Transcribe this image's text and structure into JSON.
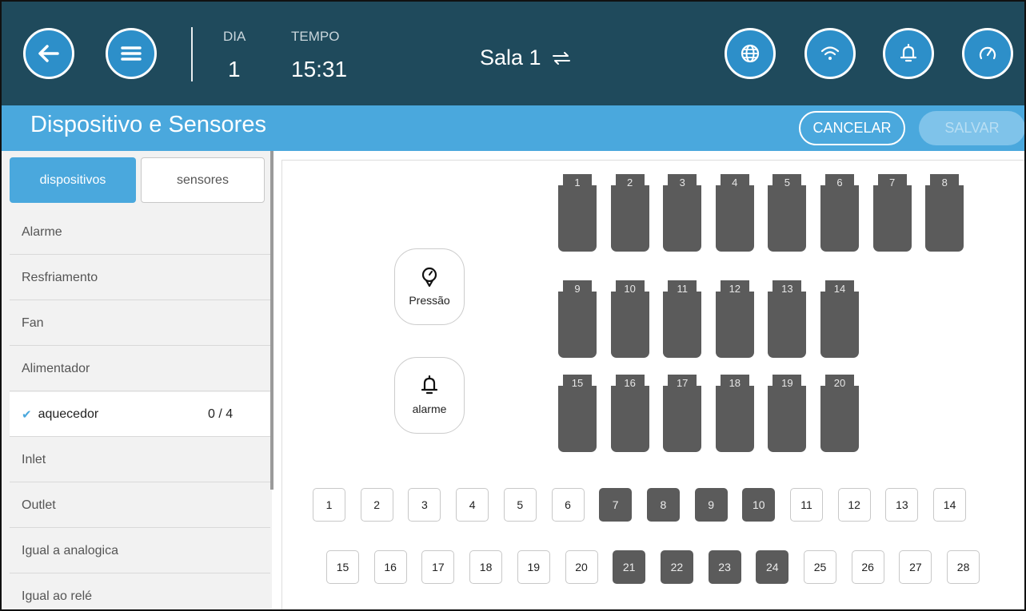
{
  "header": {
    "day_label": "DIA",
    "day_value": "1",
    "time_label": "TEMPO",
    "time_value": "15:31",
    "room": "Sala 1",
    "buttons": [
      "back-icon",
      "menu-icon",
      "globe-icon",
      "wifi-icon",
      "bell-icon",
      "gauge-icon"
    ]
  },
  "titlebar": {
    "title": "Dispositivo e Sensores",
    "cancel": "CANCELAR",
    "save": "SALVAR"
  },
  "sidebar": {
    "tabs": [
      "dispositivos",
      "sensores"
    ],
    "items": [
      {
        "label": "Alarme"
      },
      {
        "label": "Resfriamento"
      },
      {
        "label": "Fan"
      },
      {
        "label": "Alimentador"
      },
      {
        "label": "aquecedor",
        "count": "0 / 4",
        "active": true
      },
      {
        "label": "Inlet"
      },
      {
        "label": "Outlet"
      },
      {
        "label": "Igual a analogica"
      },
      {
        "label": "Igual ao relé"
      }
    ]
  },
  "panel": {
    "pressure_label": "Pressão",
    "alarm_label": "alarme",
    "heater_rows": [
      [
        "1",
        "2",
        "3",
        "4",
        "5",
        "6",
        "7",
        "8"
      ],
      [
        "9",
        "10",
        "11",
        "12",
        "13",
        "14"
      ],
      [
        "15",
        "16",
        "17",
        "18",
        "19",
        "20"
      ]
    ],
    "relays_row1": [
      "1",
      "2",
      "3",
      "4",
      "5",
      "6",
      "7",
      "8",
      "9",
      "10",
      "11",
      "12",
      "13",
      "14"
    ],
    "relays_row2": [
      "15",
      "16",
      "17",
      "18",
      "19",
      "20",
      "21",
      "22",
      "23",
      "24",
      "25",
      "26",
      "27",
      "28"
    ],
    "active_relays": [
      "7",
      "8",
      "9",
      "10",
      "21",
      "22",
      "23",
      "24"
    ]
  },
  "colors": {
    "topbar": "#1f4a5c",
    "accent": "#4aa8dd",
    "device_dark": "#5b5b5b"
  }
}
